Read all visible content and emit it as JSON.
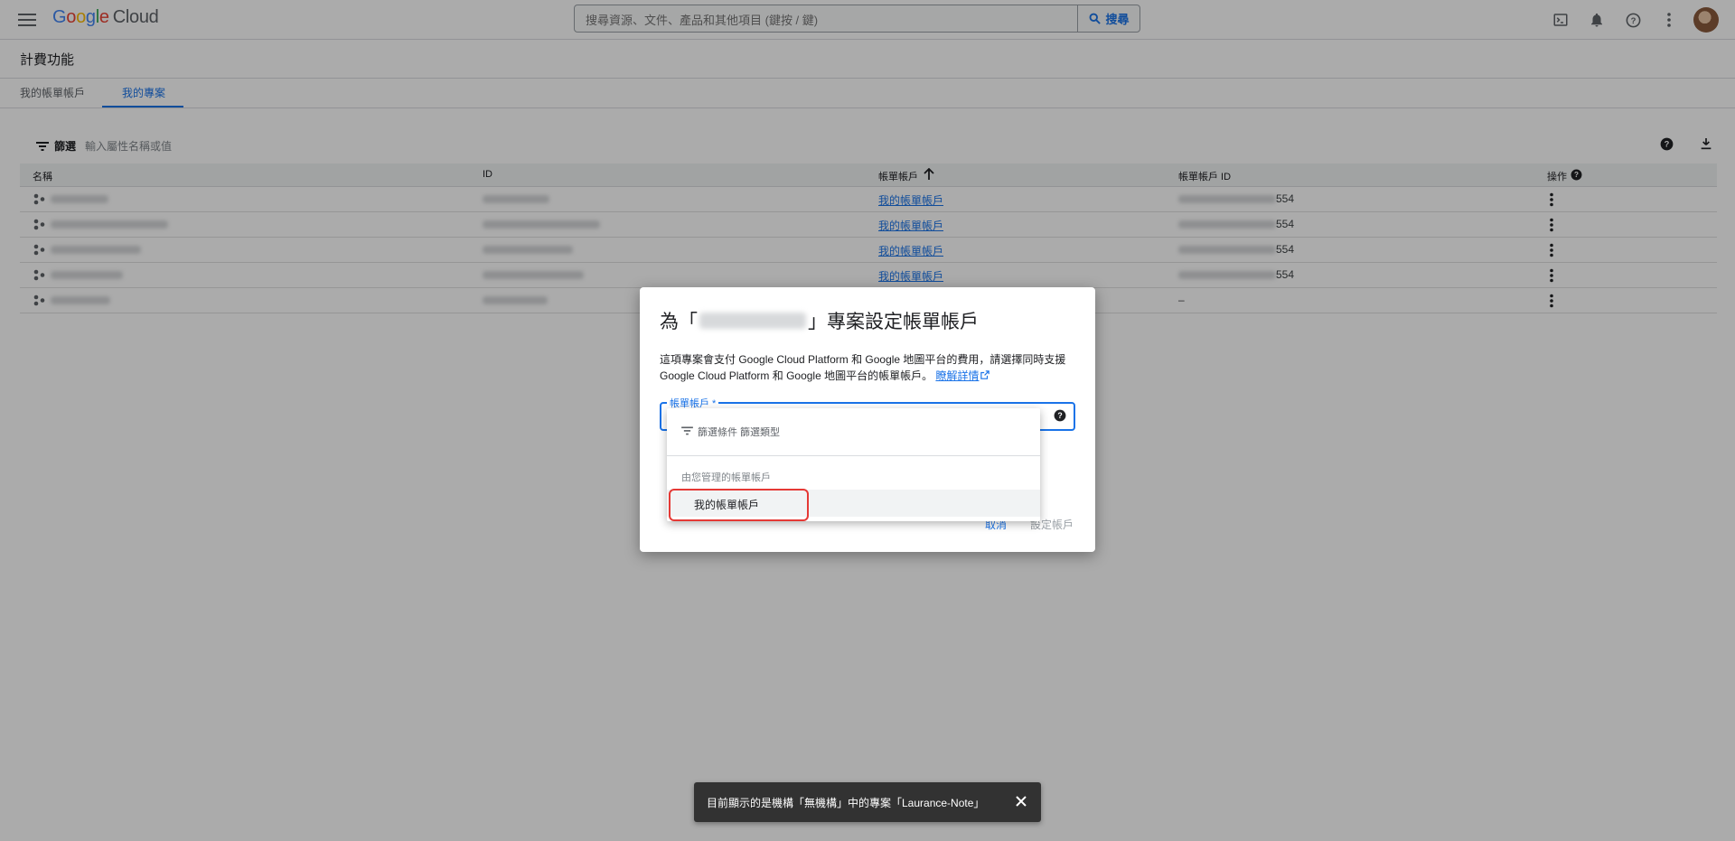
{
  "header": {
    "logo_google": "Google",
    "logo_cloud": "Cloud",
    "search_placeholder": "搜尋資源、文件、產品和其他項目 (鍵按 / 鍵)",
    "search_button": "搜尋"
  },
  "page": {
    "title": "計費功能",
    "tabs": [
      {
        "label": "我的帳單帳戶",
        "active": false
      },
      {
        "label": "我的專案",
        "active": true
      }
    ]
  },
  "filter": {
    "label": "篩選",
    "placeholder": "輸入屬性名稱或值"
  },
  "table": {
    "columns": [
      "名稱",
      "ID",
      "帳單帳戶",
      "帳單帳戶 ID",
      "操作"
    ],
    "sort_column": "帳單帳戶",
    "sort_direction": "ascending",
    "rows": [
      {
        "billing_account": "我的帳單帳戶",
        "billing_account_id": "554"
      },
      {
        "billing_account": "我的帳單帳戶",
        "billing_account_id": "554"
      },
      {
        "billing_account": "我的帳單帳戶",
        "billing_account_id": "554"
      },
      {
        "billing_account": "我的帳單帳戶",
        "billing_account_id": "554"
      },
      {
        "billing_account": "",
        "billing_account_id": "–"
      }
    ]
  },
  "dialog": {
    "title_prefix": "為「",
    "title_suffix": "」專案設定帳單帳戶",
    "description": "這項專案會支付 Google Cloud Platform 和 Google 地圖平台的費用，請選擇同時支援 Google Cloud Platform 和 Google 地圖平台的帳單帳戶。",
    "learn_more": "瞭解詳情",
    "field_label": "帳單帳戶 *",
    "cancel_button": "取消",
    "set_button": "設定帳戶"
  },
  "dropdown": {
    "filter_placeholder": "篩選條件 篩選類型",
    "group_label": "由您管理的帳單帳戶",
    "items": [
      "我的帳單帳戶"
    ]
  },
  "snackbar": {
    "text": "目前顯示的是機構「無機構」中的專案「Laurance-Note」"
  },
  "colors": {
    "accent": "#1a73e8",
    "highlight": "#e53935",
    "snackbar_bg": "#323232"
  }
}
